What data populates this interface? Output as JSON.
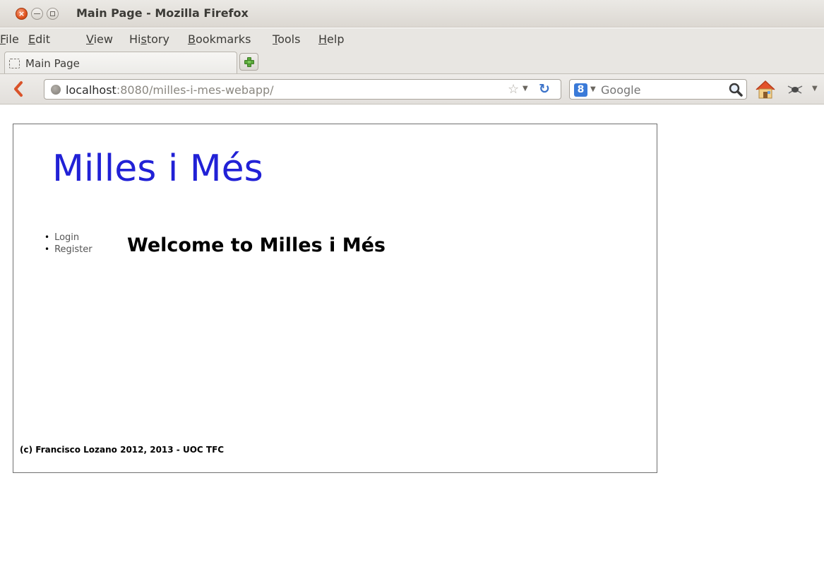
{
  "window": {
    "title": "Main Page - Mozilla Firefox",
    "close_glyph": "×"
  },
  "menubar": {
    "items": [
      {
        "label": "File",
        "accesskey": "F",
        "rest": "ile"
      },
      {
        "label": "Edit",
        "accesskey": "E",
        "rest": "dit"
      },
      {
        "label": "View",
        "accesskey": "V",
        "rest": "iew"
      },
      {
        "label": "History",
        "pre": "Hi",
        "accesskey": "s",
        "rest": "tory"
      },
      {
        "label": "Bookmarks",
        "accesskey": "B",
        "rest": "ookmarks"
      },
      {
        "label": "Tools",
        "accesskey": "T",
        "rest": "ools"
      },
      {
        "label": "Help",
        "accesskey": "H",
        "rest": "elp"
      }
    ]
  },
  "tabs": [
    {
      "label": "Main Page",
      "active": true
    }
  ],
  "navbar": {
    "url_host": "localhost",
    "url_rest": ":8080/milles-i-mes-webapp/",
    "search_placeholder": "Google",
    "search_engine_glyph": "8"
  },
  "page": {
    "site_title": "Milles i Més",
    "menu": [
      "Login",
      "Register"
    ],
    "heading": "Welcome to Milles i Més",
    "footer": "(c) Francisco Lozano 2012, 2013 - UOC TFC"
  },
  "colors": {
    "site_title": "#2121d6",
    "menu_text": "#555555",
    "reload": "#3b72c8",
    "new_tab_plus": "#5aa83a"
  }
}
